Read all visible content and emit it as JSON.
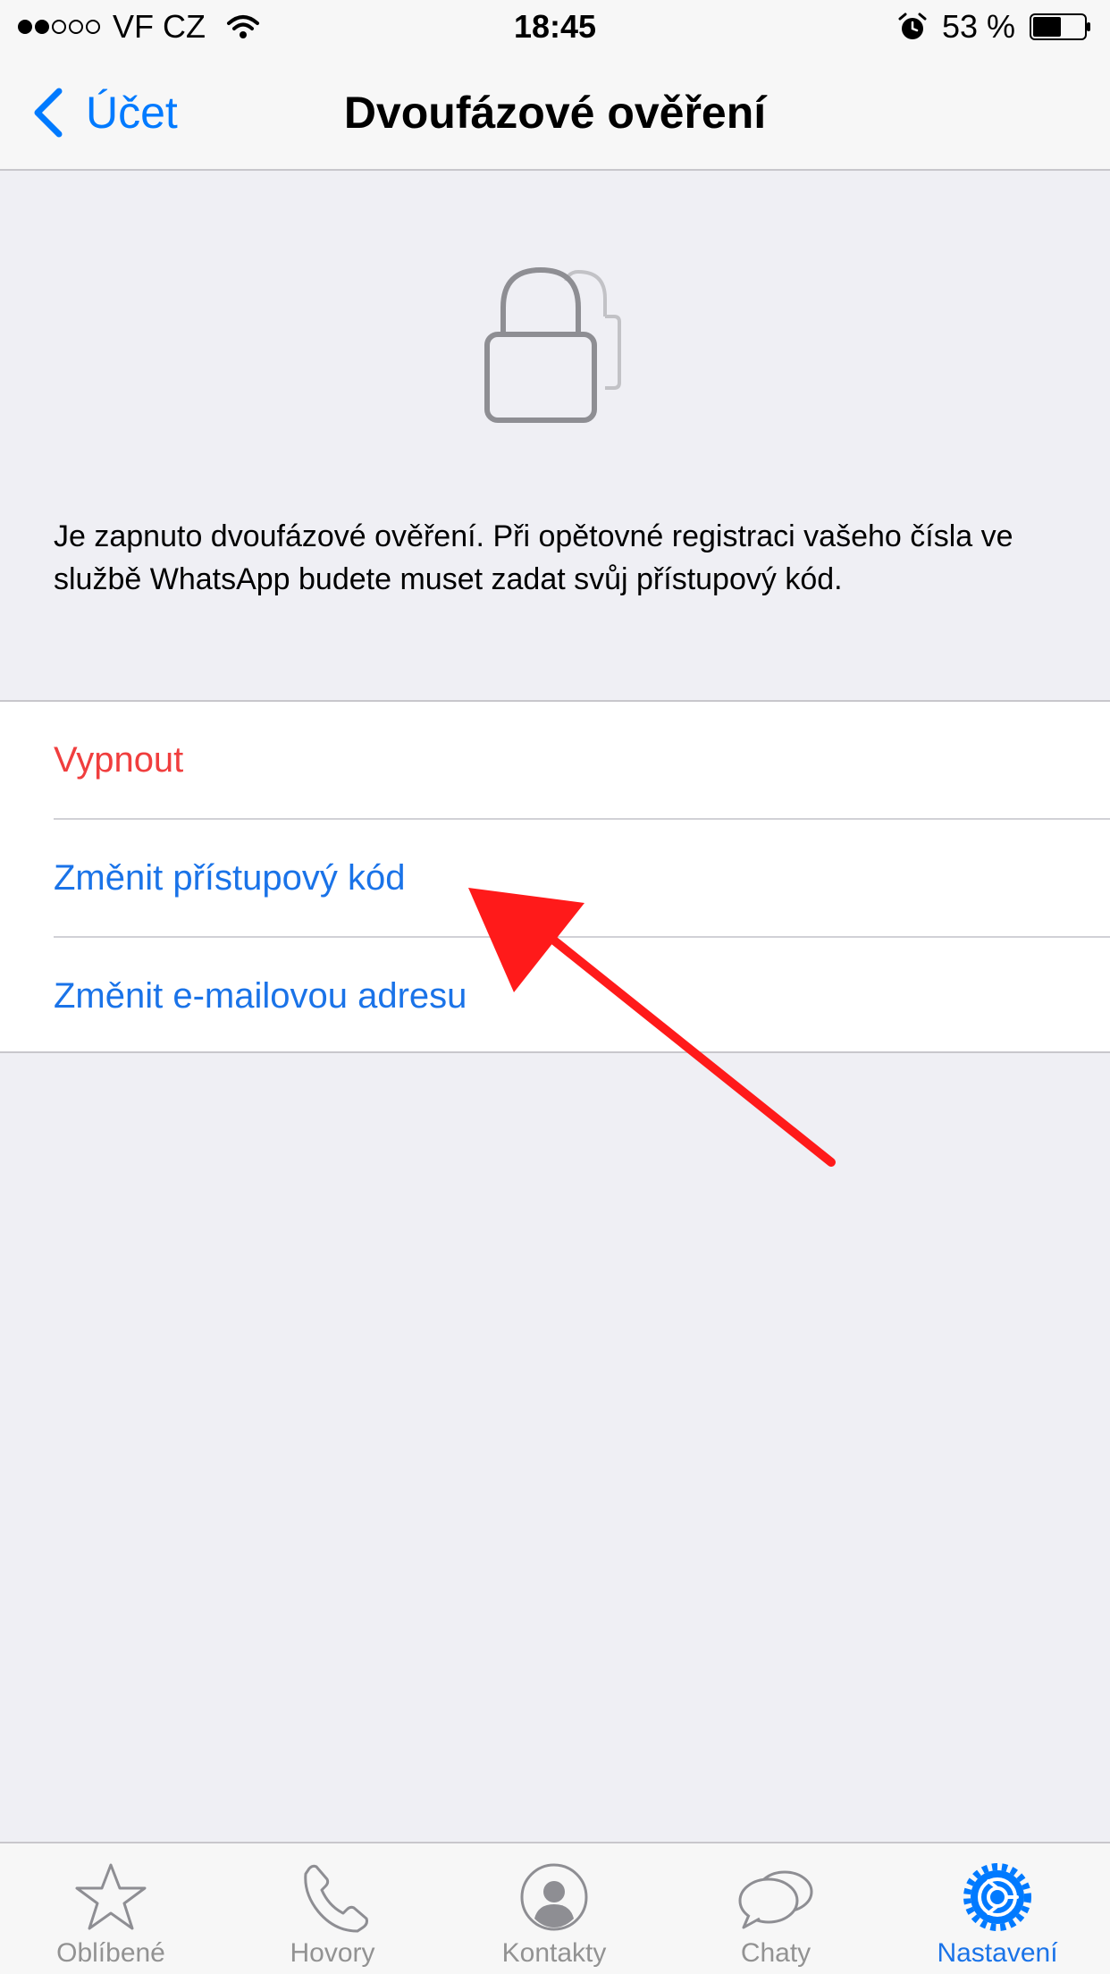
{
  "status_bar": {
    "carrier": "VF CZ",
    "time": "18:45",
    "battery": "53 %"
  },
  "nav": {
    "back_label": "Účet",
    "title": "Dvoufázové ověření"
  },
  "description": "Je zapnuto dvoufázové ověření. Při opětovné registraci vašeho čísla ve službě WhatsApp budete muset zadat svůj přístupový kód.",
  "options": [
    {
      "label": "Vypnout"
    },
    {
      "label": "Změnit přístupový kód"
    },
    {
      "label": "Změnit e-mailovou adresu"
    }
  ],
  "tabs": [
    {
      "label": "Oblíbené",
      "icon": "star-icon"
    },
    {
      "label": "Hovory",
      "icon": "phone-icon"
    },
    {
      "label": "Kontakty",
      "icon": "contact-icon"
    },
    {
      "label": "Chaty",
      "icon": "chat-icon"
    },
    {
      "label": "Nastavení",
      "icon": "settings-icon",
      "active": true
    }
  ],
  "colors": {
    "accent": "#007aff",
    "destructive": "#f03e3e",
    "annotation_arrow": "#ff0000"
  }
}
